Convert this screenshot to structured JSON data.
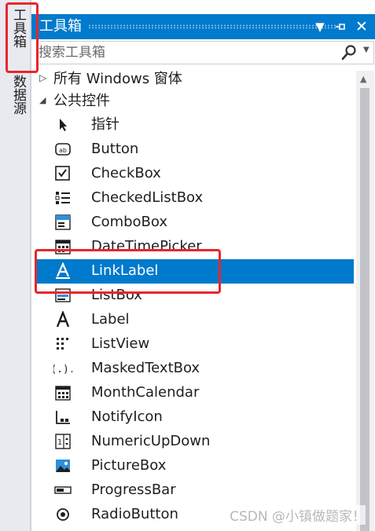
{
  "side_tabs": {
    "toolbox": "工具箱",
    "datasource": "数据源"
  },
  "panel": {
    "title": "工具箱",
    "search_placeholder": "搜索工具箱"
  },
  "tree": {
    "categories": [
      {
        "label": "所有 Windows 窗体",
        "expanded": false
      },
      {
        "label": "公共控件",
        "expanded": true
      }
    ],
    "items": [
      {
        "label": "指针",
        "icon": "pointer-icon"
      },
      {
        "label": "Button",
        "icon": "button-icon"
      },
      {
        "label": "CheckBox",
        "icon": "checkbox-icon"
      },
      {
        "label": "CheckedListBox",
        "icon": "checkedlistbox-icon"
      },
      {
        "label": "ComboBox",
        "icon": "combobox-icon"
      },
      {
        "label": "DateTimePicker",
        "icon": "datetimepicker-icon"
      },
      {
        "label": "LinkLabel",
        "icon": "linklabel-icon",
        "selected": true
      },
      {
        "label": "ListBox",
        "icon": "listbox-icon"
      },
      {
        "label": "Label",
        "icon": "label-icon"
      },
      {
        "label": "ListView",
        "icon": "listview-icon"
      },
      {
        "label": "MaskedTextBox",
        "icon": "maskedtextbox-icon"
      },
      {
        "label": "MonthCalendar",
        "icon": "monthcalendar-icon"
      },
      {
        "label": "NotifyIcon",
        "icon": "notifyicon-icon"
      },
      {
        "label": "NumericUpDown",
        "icon": "numericupdown-icon"
      },
      {
        "label": "PictureBox",
        "icon": "picturebox-icon"
      },
      {
        "label": "ProgressBar",
        "icon": "progressbar-icon"
      },
      {
        "label": "RadioButton",
        "icon": "radiobutton-icon"
      }
    ]
  },
  "watermark": "CSDN @小镇做题家！",
  "colors": {
    "accent": "#007acc",
    "annotation_red": "#e8262b"
  }
}
